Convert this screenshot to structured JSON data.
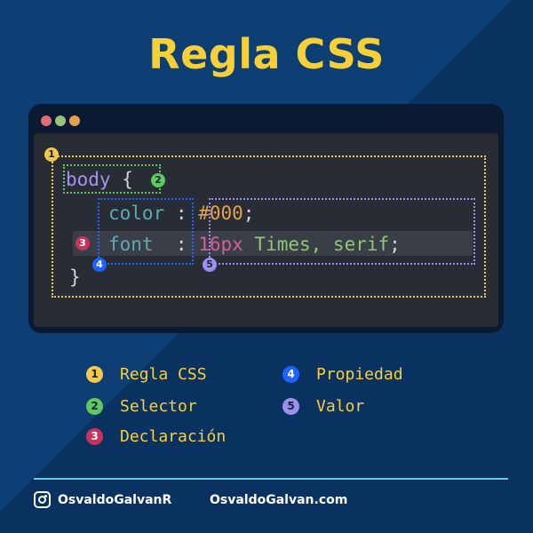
{
  "title": "Regla CSS",
  "window_dots": [
    {
      "name": "close",
      "color": "#e06c75"
    },
    {
      "name": "minimize",
      "color": "#98c379"
    },
    {
      "name": "zoom",
      "color": "#e5a14b"
    }
  ],
  "code": {
    "selector": "body",
    "open_brace": "{",
    "line1": {
      "property": "color",
      "colon": ":",
      "value": "#000",
      "semicolon": ";"
    },
    "line2": {
      "property": "font",
      "colon": ":",
      "value_num": "16px",
      "value_text": "Times, serif",
      "semicolon": ";"
    },
    "close_brace": "}"
  },
  "badges": {
    "rule": "1",
    "selector": "2",
    "declaration": "3",
    "property": "4",
    "value": "5"
  },
  "colors": {
    "rule": "#f2c94c",
    "selector": "#5fc95f",
    "declaration": "#c8335d",
    "property": "#1e63ff",
    "value": "#9b8ff0"
  },
  "legend": [
    {
      "number": "1",
      "label": "Regla CSS"
    },
    {
      "number": "2",
      "label": "Selector"
    },
    {
      "number": "3",
      "label": "Declaración"
    },
    {
      "number": "4",
      "label": "Propiedad"
    },
    {
      "number": "5",
      "label": "Valor"
    }
  ],
  "footer": {
    "handle": "OsvaldoGalvanR",
    "website": "OsvaldoGalvan.com",
    "icon": "instagram-icon"
  }
}
